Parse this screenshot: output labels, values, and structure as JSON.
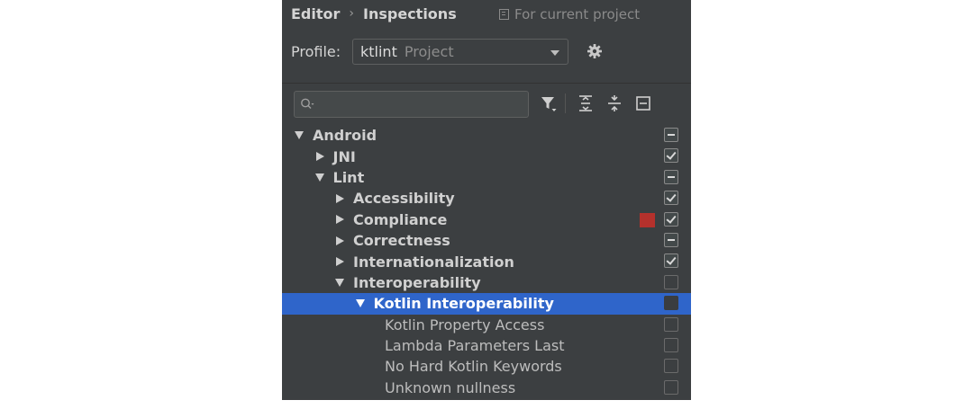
{
  "breadcrumb": {
    "parent": "Editor",
    "current": "Inspections"
  },
  "scope_note": "For current project",
  "profile": {
    "label": "Profile:",
    "name": "ktlint",
    "scope": "Project"
  },
  "search": {
    "placeholder": ""
  },
  "colors": {
    "selection": "#2f65ca",
    "severity_error": "#b5312c",
    "panel_bg": "#3c3f41"
  },
  "icons": [
    "gear-icon",
    "search-icon",
    "filter-icon",
    "expand-all-icon",
    "collapse-all-icon",
    "reset-icon"
  ],
  "tree": [
    {
      "label": "Android",
      "level": 0,
      "expander": "down",
      "bold": true,
      "check": "partial"
    },
    {
      "label": "JNI",
      "level": 1,
      "expander": "right",
      "bold": true,
      "check": "checked"
    },
    {
      "label": "Lint",
      "level": 1,
      "expander": "down",
      "bold": true,
      "check": "partial"
    },
    {
      "label": "Accessibility",
      "level": 2,
      "expander": "right",
      "bold": true,
      "check": "checked"
    },
    {
      "label": "Compliance",
      "level": 2,
      "expander": "right",
      "bold": true,
      "check": "checked",
      "severity": "error"
    },
    {
      "label": "Correctness",
      "level": 2,
      "expander": "right",
      "bold": true,
      "check": "partial"
    },
    {
      "label": "Internationalization",
      "level": 2,
      "expander": "right",
      "bold": true,
      "check": "checked"
    },
    {
      "label": "Interoperability",
      "level": 2,
      "expander": "down",
      "bold": true,
      "check": "unchecked"
    },
    {
      "label": "Kotlin Interoperability",
      "level": 3,
      "expander": "down",
      "bold": true,
      "check": "unchecked",
      "selected": true
    },
    {
      "label": "Kotlin Property Access",
      "level": 4,
      "expander": "none",
      "bold": false,
      "check": "unchecked"
    },
    {
      "label": "Lambda Parameters Last",
      "level": 4,
      "expander": "none",
      "bold": false,
      "check": "unchecked"
    },
    {
      "label": "No Hard Kotlin Keywords",
      "level": 4,
      "expander": "none",
      "bold": false,
      "check": "unchecked"
    },
    {
      "label": "Unknown nullness",
      "level": 4,
      "expander": "none",
      "bold": false,
      "check": "unchecked"
    }
  ]
}
